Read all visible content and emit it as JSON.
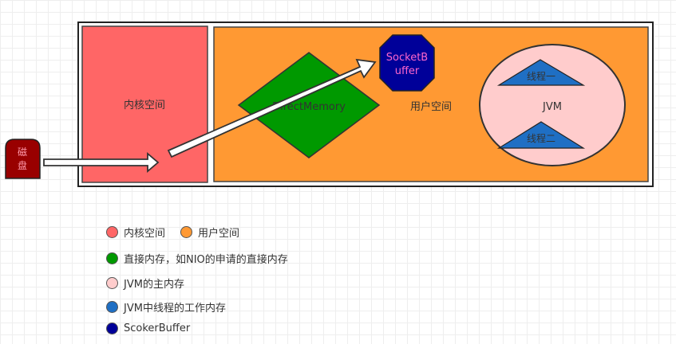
{
  "diagram": {
    "disk": "磁盘",
    "kernel_space": "内核空间",
    "direct_memory": "DirectMemory",
    "socket_buffer_line1": "SocketB",
    "socket_buffer_line2": "uffer",
    "user_space": "用户空间",
    "jvm": "JVM",
    "thread_one": "线程一",
    "thread_two": "线程二"
  },
  "legend": {
    "kernel": "内核空间",
    "user": "用户空间",
    "direct": "直接内存，如NIO的申请的直接内存",
    "jvm_main": "JVM的主内存",
    "thread_working": "JVM中线程的工作内存",
    "socker_buffer": "ScokerBuffer"
  },
  "colors": {
    "kernel": "#ff6666",
    "user": "#ff9933",
    "direct": "#009900",
    "jvm": "#ffcccc",
    "thread": "#1f6fc4",
    "socket_buffer": "#000099"
  }
}
